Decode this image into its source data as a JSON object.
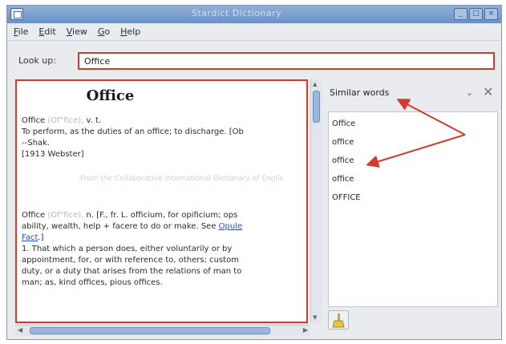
{
  "window": {
    "title": "Stardict Dictionary",
    "buttons": [
      "_",
      "□",
      "×"
    ]
  },
  "menu": [
    {
      "first": "F",
      "rest": "ile"
    },
    {
      "first": "E",
      "rest": "dit"
    },
    {
      "first": "V",
      "rest": "iew"
    },
    {
      "first": "G",
      "rest": "o"
    },
    {
      "first": "H",
      "rest": "elp"
    }
  ],
  "lookup": {
    "label": "Look up:",
    "value": "Office"
  },
  "definition": {
    "word": "Office",
    "entry1": {
      "head": "Office",
      "pron": "(Of\"fice),",
      "pos": "v. t.",
      "lines": [
        "To perform, as the duties of an office; to discharge. [Ob",
        "--Shak.",
        "[1913 Webster]"
      ]
    },
    "separator": "-From the Collaborative International Dictionary of Englis",
    "entry2": {
      "head": "Office",
      "pron": "(Of\"fice),",
      "text1": "n. [F., fr. L. officium, for opificium; ops",
      "text2": "ability, wealth, help + facere to do or make. See",
      "link1": "Opule",
      "link2": "Fact",
      "text3": ".]",
      "lines": [
        "1. That which a person does, either voluntarily or by",
        "appointment, for, or with reference to, others; custom",
        "duty, or a duty that arises from the relations of man to",
        "man; as, kind offices, pious offices."
      ]
    }
  },
  "similar_words": {
    "title": "Similar words",
    "items": [
      "Office",
      "office",
      "office",
      "office",
      "OFFICE"
    ]
  },
  "colors": {
    "highlight": "#d23a2c",
    "titlebar": "#6a91c6"
  },
  "icons": {
    "app": "dictionary-icon",
    "dropdown": "chevron-down-icon",
    "close": "close-icon",
    "clear": "broom-icon"
  }
}
